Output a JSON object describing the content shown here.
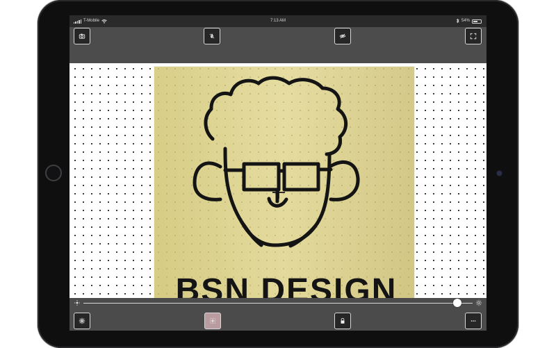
{
  "status_bar": {
    "carrier": "T-Mobile",
    "time": "7:13 AM",
    "battery_percent": "54%"
  },
  "toolbar_top": {
    "camera_icon": "camera-icon",
    "clean_icon": "drop-slash-icon",
    "visibility_icon": "eye-slash-icon",
    "fullscreen_icon": "fullscreen-icon"
  },
  "slider": {
    "value": 0.96,
    "left_icon": "brightness-low-icon",
    "right_icon": "brightness-high-icon"
  },
  "toolbar_bottom": {
    "settings_icon": "gear-icon",
    "crosshair_icon": "crosshair-icon",
    "lock_icon": "lock-icon",
    "more_icon": "ellipsis-icon"
  },
  "canvas": {
    "drawing_text": "BSN DESIGN"
  },
  "colors": {
    "screen_background": "#ffffff",
    "toolbar_background": "#4c4c4d",
    "status_bar_background": "#2a2a2b",
    "sketch_paper": "#d8cd87",
    "ink": "#141414"
  }
}
